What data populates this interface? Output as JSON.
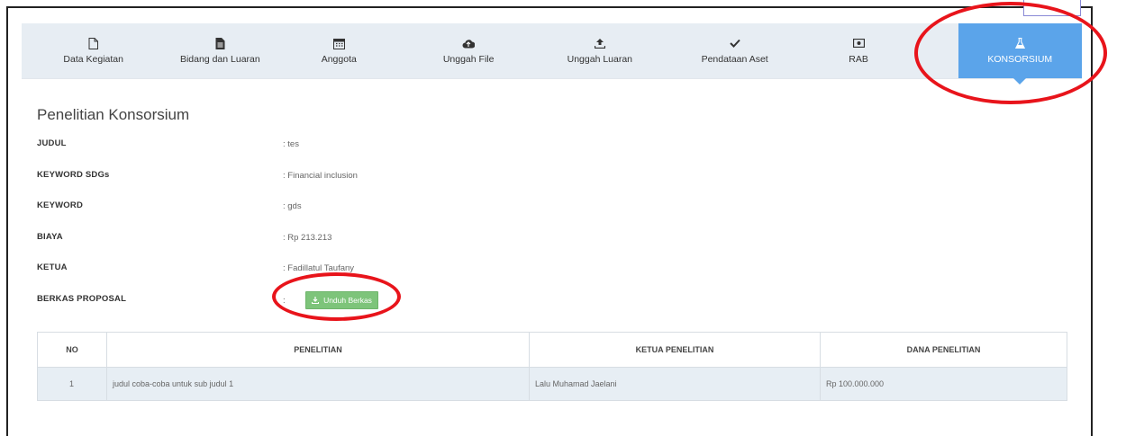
{
  "tabs": [
    {
      "label": "Data Kegiatan",
      "icon": "file-outline-icon"
    },
    {
      "label": "Bidang dan Luaran",
      "icon": "file-text-icon"
    },
    {
      "label": "Anggota",
      "icon": "calendar-icon"
    },
    {
      "label": "Unggah File",
      "icon": "cloud-upload-icon"
    },
    {
      "label": "Unggah Luaran",
      "icon": "upload-icon"
    },
    {
      "label": "Pendataan Aset",
      "icon": "check-icon"
    },
    {
      "label": "RAB",
      "icon": "money-icon"
    },
    {
      "label": "KONSORSIUM",
      "icon": "flask-icon",
      "active": true
    }
  ],
  "page_title": "Penelitian Konsorsium",
  "info": {
    "judul_label": "JUDUL",
    "judul_value": ": tes",
    "sdg_label": "KEYWORD SDGs",
    "sdg_value": ": Financial inclusion",
    "keyword_label": "KEYWORD",
    "keyword_value": ": gds",
    "biaya_label": "BIAYA",
    "biaya_value": ": Rp 213.213",
    "ketua_label": "KETUA",
    "ketua_value": ": Fadillatul Taufany",
    "berkas_label": "BERKAS PROPOSAL",
    "berkas_colon": ":",
    "download_label": "Unduh Berkas"
  },
  "table": {
    "headers": [
      "NO",
      "PENELITIAN",
      "KETUA PENELITIAN",
      "DANA PENELITIAN"
    ],
    "rows": [
      [
        "1",
        "judul coba-coba untuk sub judul 1",
        "Lalu Muhamad Jaelani",
        "Rp 100.000.000"
      ]
    ]
  },
  "colors": {
    "active_tab": "#5ba4ea",
    "tabbar_bg": "#e7edf3",
    "download_button": "#7dc47a",
    "annotation": "#e8141b"
  }
}
